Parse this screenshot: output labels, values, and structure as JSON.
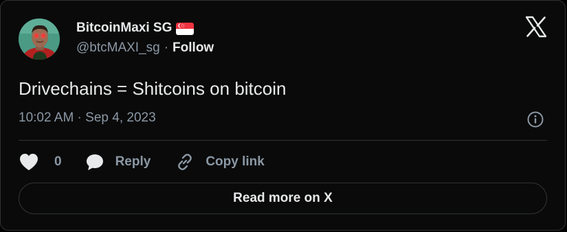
{
  "author": {
    "name": "BitcoinMaxi SG",
    "flag_icon": "singapore-flag-icon",
    "handle": "@btcMAXI_sg",
    "separator": "·",
    "follow_label": "Follow"
  },
  "tweet": {
    "text": "Drivechains = Shitcoins on bitcoin",
    "timestamp": "10:02 AM · Sep 4, 2023"
  },
  "actions": {
    "like_count": "0",
    "reply_label": "Reply",
    "copy_link_label": "Copy link"
  },
  "read_more_label": "Read more on X",
  "colors": {
    "background": "#000000",
    "text_primary": "#e7e9ea",
    "text_secondary": "#8b98a5",
    "border": "#2f3336"
  }
}
